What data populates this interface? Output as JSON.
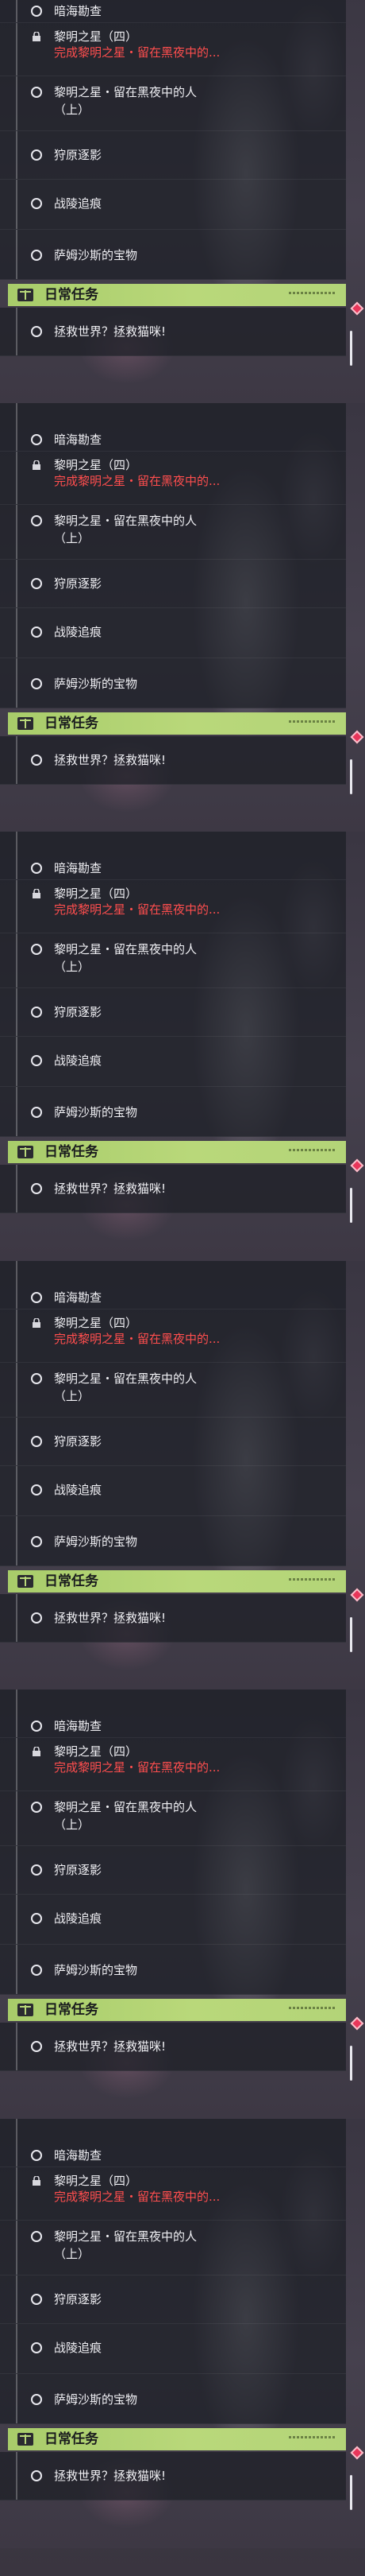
{
  "quests": [
    {
      "title": "暗海勘查",
      "state": "circle"
    },
    {
      "title": "黎明之星（四）",
      "subtitle": "完成黎明之星・留在黑夜中的...",
      "state": "lock"
    },
    {
      "title": "黎明之星・留在黑夜中的人",
      "title2": "（上）",
      "state": "circle"
    },
    {
      "title": "狩原逐影",
      "state": "circle"
    },
    {
      "title": "战陵追痕",
      "state": "circle"
    },
    {
      "title": "萨姆沙斯的宝物",
      "state": "circle"
    }
  ],
  "daily": {
    "header": "日常任务",
    "item": "拯救世界？拯救猫咪!"
  },
  "colors": {
    "accent_green": "#b9d87a",
    "subtitle_red": "#ff4e4e",
    "badge_red": "#e8365a"
  },
  "icons": [
    "circle-icon",
    "lock-icon",
    "book-icon",
    "diamond-badge-icon"
  ]
}
